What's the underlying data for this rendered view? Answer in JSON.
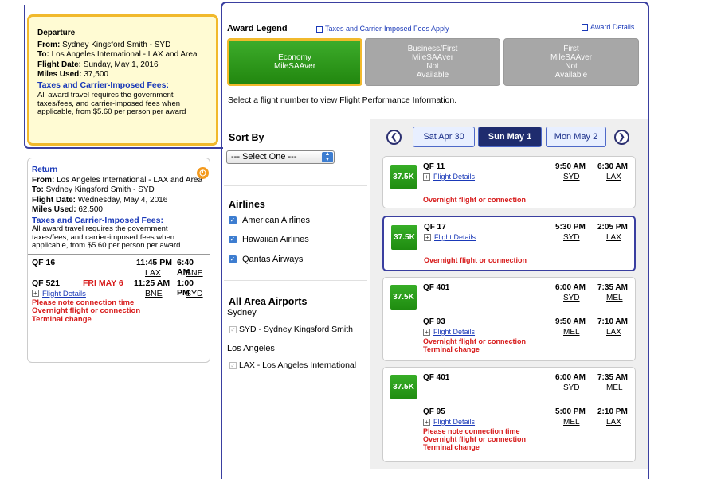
{
  "departure": {
    "heading": "Departure",
    "from_label": "From:",
    "from": "Sydney Kingsford Smith - SYD",
    "to_label": "To:",
    "to": "Los Angeles International - LAX and Area",
    "date_label": "Flight Date:",
    "date": "Sunday, May 1, 2016",
    "miles_label": "Miles Used:",
    "miles": "37,500",
    "fees_title": "Taxes and Carrier-Imposed Fees:",
    "fees_text": "All award travel requires the government taxes/fees, and carrier-imposed fees when applicable, from $5.60 per person per award"
  },
  "return": {
    "heading": "Return",
    "from_label": "From:",
    "from": "Los Angeles International - LAX and Area",
    "to_label": "To:",
    "to": "Sydney Kingsford Smith - SYD",
    "date_label": "Flight Date:",
    "date": "Wednesday, May 4, 2016",
    "miles_label": "Miles Used:",
    "miles": "62,500",
    "fees_title": "Taxes and Carrier-Imposed Fees:",
    "fees_text": "All award travel requires the government taxes/fees, and carrier-imposed fees when applicable, from $5.60 per person per award",
    "seg1": {
      "flight": "QF 16",
      "dep_time": "11:45 PM",
      "arr_time": "6:40 AM",
      "from": "LAX",
      "to": "BNE"
    },
    "seg2": {
      "flight": "QF 521",
      "day": "FRI MAY 6",
      "dep_time": "11:25 AM",
      "arr_time": "1:00 PM",
      "from": "BNE",
      "to": "SYD"
    },
    "details_link": "Flight Details",
    "warnings": [
      "Please note connection time",
      "Overnight flight or connection",
      "Terminal change"
    ]
  },
  "legend": {
    "title": "Award Legend",
    "taxes_link": "Taxes and Carrier-Imposed Fees Apply",
    "details_link": "Award Details",
    "buttons": [
      {
        "line1": "Economy",
        "line2": "MileSAAver",
        "line3": "",
        "line4": ""
      },
      {
        "line1": "Business/First",
        "line2": "MileSAAver",
        "line3": "Not",
        "line4": "Available"
      },
      {
        "line1": "First",
        "line2": "MileSAAver",
        "line3": "Not",
        "line4": "Available"
      }
    ],
    "instruction": "Select a flight number to view Flight Performance Information."
  },
  "filters": {
    "sort_title": "Sort By",
    "sort_value": "--- Select One ---",
    "airlines_title": "Airlines",
    "airlines": [
      "American Airlines",
      "Hawaiian Airlines",
      "Qantas Airways"
    ],
    "airports_title": "All Area Airports",
    "city1": "Sydney",
    "airport1": "SYD - Sydney Kingsford Smith",
    "city2": "Los Angeles",
    "airport2": "LAX - Los Angeles International"
  },
  "dates": {
    "prev": "Sat Apr 30",
    "current": "Sun May 1",
    "next": "Mon May 2"
  },
  "flights": [
    {
      "miles": "37.5K",
      "segments": [
        {
          "flight": "QF 11",
          "dep": "9:50 AM",
          "arr": "6:30 AM",
          "from": "SYD",
          "to": "LAX",
          "link": "Flight Details",
          "warnings": [
            "Overnight flight or connection"
          ]
        }
      ]
    },
    {
      "miles": "37.5K",
      "segments": [
        {
          "flight": "QF 17",
          "dep": "5:30 PM",
          "arr": "2:05 PM",
          "from": "SYD",
          "to": "LAX",
          "link": "Flight Details",
          "warnings": [
            "Overnight flight or connection"
          ]
        }
      ]
    },
    {
      "miles": "37.5K",
      "segments": [
        {
          "flight": "QF 401",
          "dep": "6:00 AM",
          "arr": "7:35 AM",
          "from": "SYD",
          "to": "MEL"
        },
        {
          "flight": "QF 93",
          "dep": "9:50 AM",
          "arr": "7:10 AM",
          "from": "MEL",
          "to": "LAX",
          "link": "Flight Details",
          "warnings": [
            "Overnight flight or connection",
            "Terminal change"
          ]
        }
      ]
    },
    {
      "miles": "37.5K",
      "segments": [
        {
          "flight": "QF 401",
          "dep": "6:00 AM",
          "arr": "7:35 AM",
          "from": "SYD",
          "to": "MEL"
        },
        {
          "flight": "QF 95",
          "dep": "5:00 PM",
          "arr": "2:10 PM",
          "from": "MEL",
          "to": "LAX",
          "link": "Flight Details",
          "warnings": [
            "Please note connection time",
            "Overnight flight or connection",
            "Terminal change"
          ]
        }
      ]
    }
  ],
  "colors": {
    "accent": "#1a39b8",
    "award_green": "#22870f",
    "warning": "#d71a1a",
    "highlight": "#f1b92c"
  }
}
